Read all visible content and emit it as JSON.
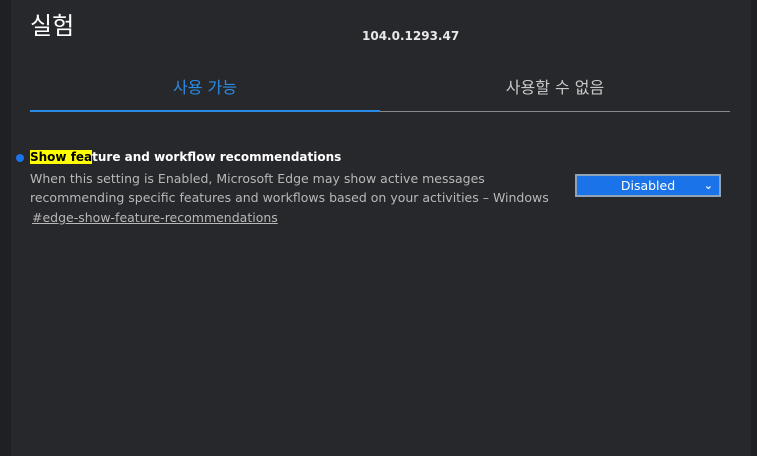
{
  "page": {
    "title": "실험",
    "version": "104.0.1293.47"
  },
  "tabs": {
    "available": "사용 가능",
    "unavailable": "사용할 수 없음"
  },
  "flag": {
    "name_highlight": "Show fea",
    "name_rest": "ture and workflow recommendations",
    "description": "When this setting is Enabled, Microsoft Edge may show active messages recommending specific features and workflows based on your activities – Windows",
    "anchor": "#edge-show-feature-recommendations",
    "selected_value": "Disabled"
  },
  "colors": {
    "accent": "#2a8be6",
    "highlight": "#ffff00",
    "background": "#27282c"
  }
}
